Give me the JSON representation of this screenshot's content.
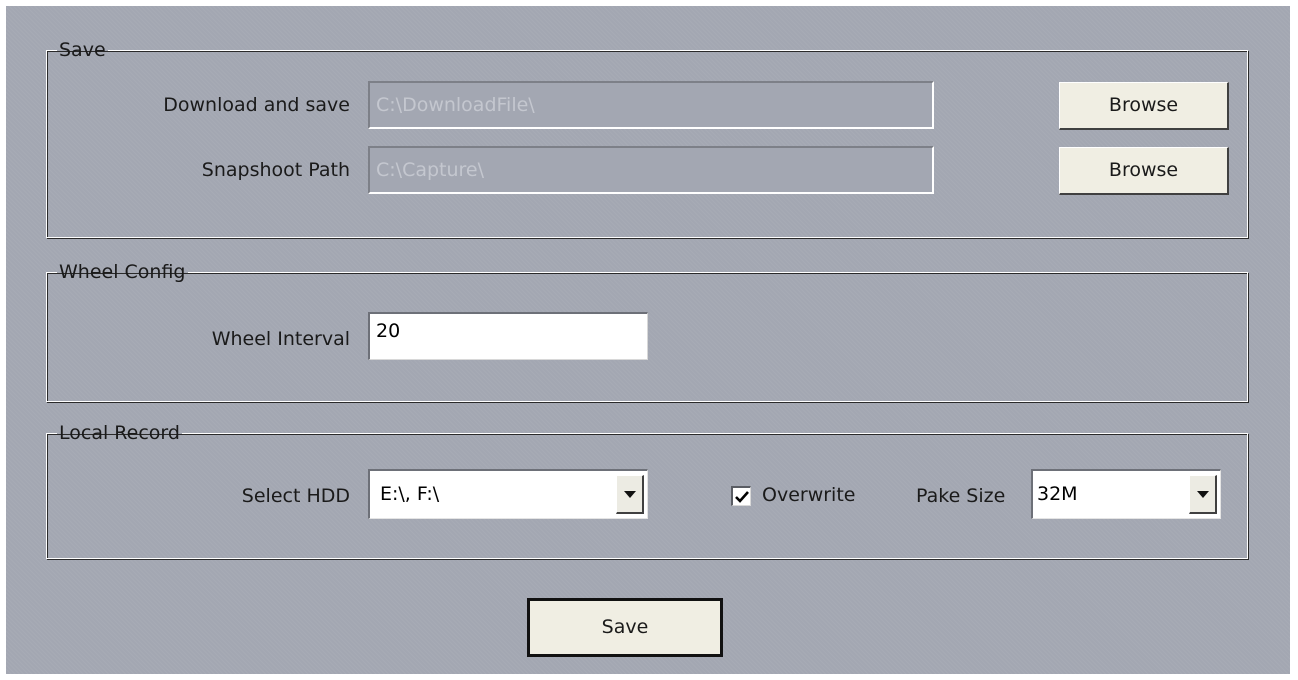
{
  "save_group": {
    "legend": "Save",
    "download_label": "Download and save",
    "download_value": "C:\\DownloadFile\\",
    "snapshot_label": "Snapshoot Path",
    "snapshot_value": "C:\\Capture\\",
    "browse_label": "Browse"
  },
  "wheel_group": {
    "legend": "Wheel Config",
    "interval_label": "Wheel Interval",
    "interval_value": "20"
  },
  "record_group": {
    "legend": "Local Record",
    "hdd_label": "Select HDD",
    "hdd_value": "E:\\, F:\\",
    "overwrite_label": "Overwrite",
    "overwrite_checked": true,
    "pack_label": "Pake Size",
    "pack_value": "32M"
  },
  "actions": {
    "save_label": "Save"
  },
  "colors": {
    "panel_background": "#a3a7b2",
    "button_face": "#f0eee3",
    "disabled_text": "#c4c7cf"
  }
}
